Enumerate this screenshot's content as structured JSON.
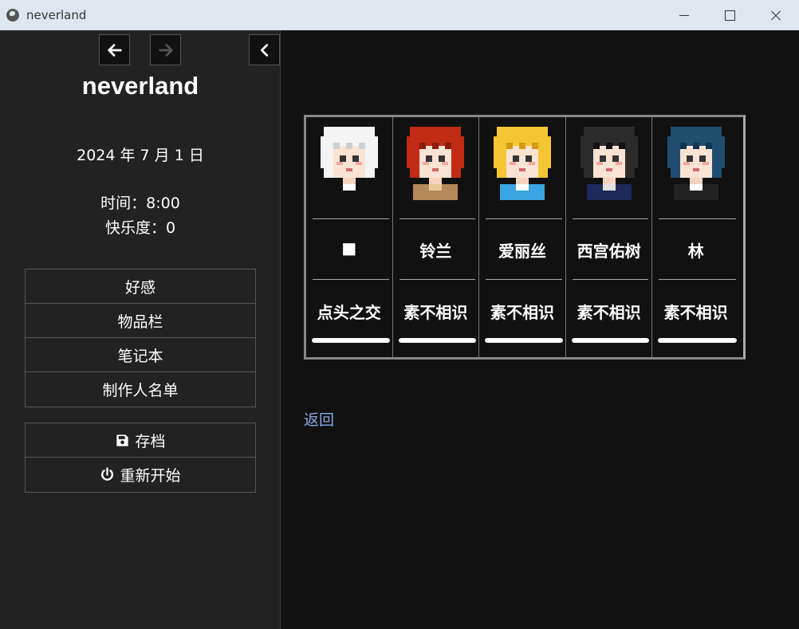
{
  "window": {
    "title": "neverland"
  },
  "sidebar": {
    "story_title": "neverland",
    "date": "2024 年 7 月 1 日",
    "time": "时间：8:00",
    "happiness": "快乐度：0",
    "menu": [
      {
        "label": "好感"
      },
      {
        "label": "物品栏"
      },
      {
        "label": "笔记本"
      },
      {
        "label": "制作人名单"
      }
    ],
    "system": [
      {
        "label": "存档",
        "icon": "save-icon"
      },
      {
        "label": "重新开始",
        "icon": "power-icon"
      }
    ]
  },
  "characters": [
    {
      "name": "■",
      "relation": "点头之交",
      "affinity": 1.0,
      "hair": "#f4f4f4",
      "hair_dark": "#cfcfcf",
      "outfit": "#111111",
      "collar": "#ffffff"
    },
    {
      "name": "铃兰",
      "relation": "素不相识",
      "affinity": 1.0,
      "hair": "#c12b14",
      "hair_dark": "#8a1c0c",
      "outfit": "#b5895a",
      "collar": "#e8c89a"
    },
    {
      "name": "爱丽丝",
      "relation": "素不相识",
      "affinity": 1.0,
      "hair": "#f5c633",
      "hair_dark": "#d49a14",
      "outfit": "#3aa5e0",
      "collar": "#ffffff"
    },
    {
      "name": "西宫佑树",
      "relation": "素不相识",
      "affinity": 1.0,
      "hair": "#2b2b2b",
      "hair_dark": "#111111",
      "outfit": "#1d2a5a",
      "collar": "#e0e0e0"
    },
    {
      "name": "林",
      "relation": "素不相识",
      "affinity": 1.0,
      "hair": "#1f4d70",
      "hair_dark": "#133552",
      "outfit": "#222222",
      "collar": "#ffffff"
    }
  ],
  "main": {
    "back_link": "返回"
  }
}
